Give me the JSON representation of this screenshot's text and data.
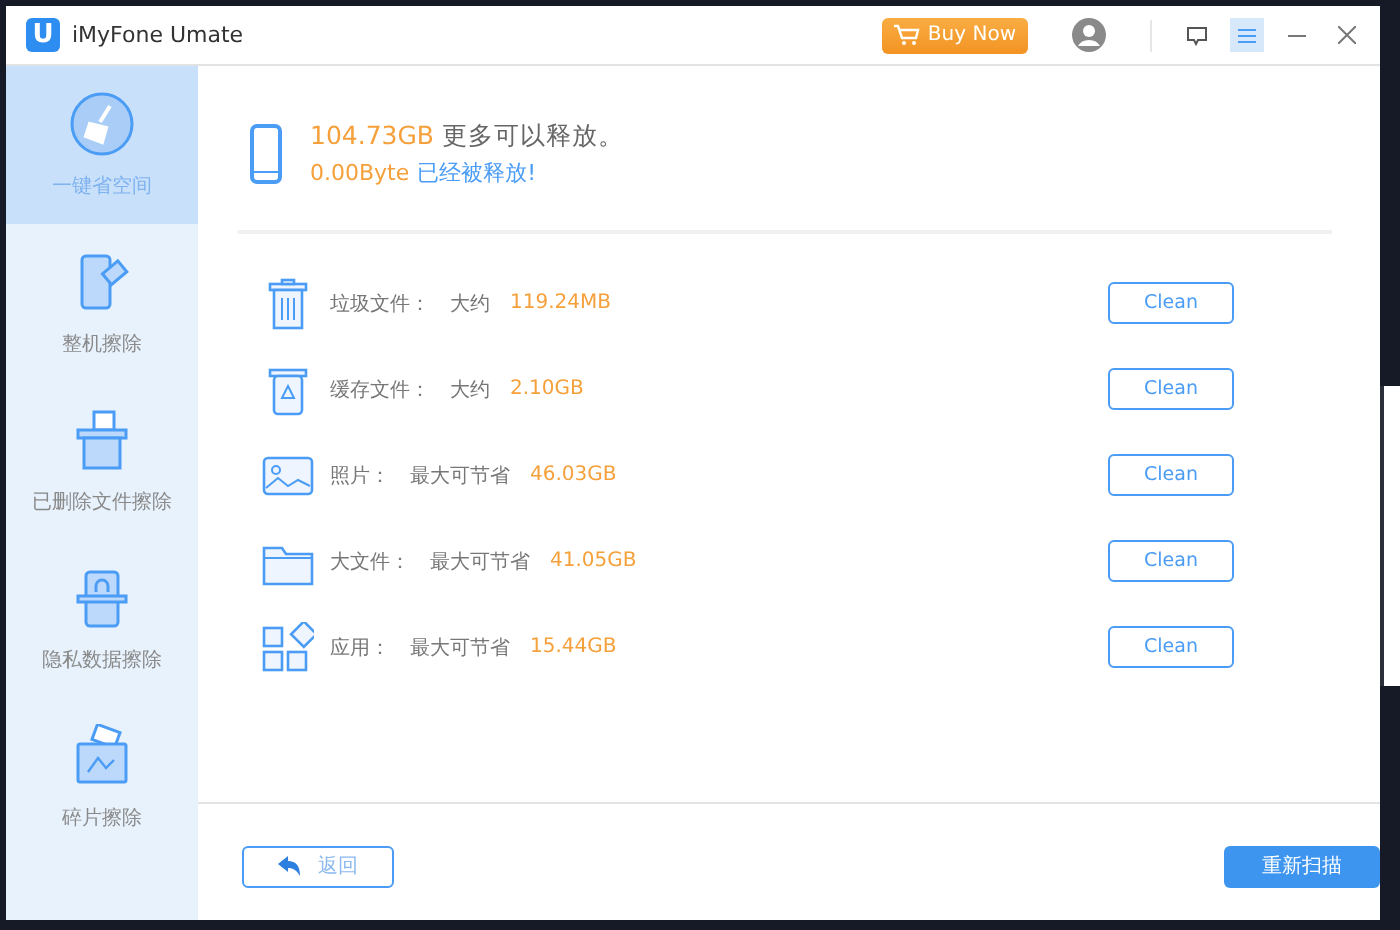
{
  "window": {
    "title": "iMyFone Umate",
    "logo": "U"
  },
  "toolbar": {
    "buy_button": "Buy Now"
  },
  "sidebar": {
    "items": [
      {
        "label": "一键省空间",
        "kind": "broom",
        "selected": true
      },
      {
        "label": "整机擦除",
        "kind": "phone",
        "selected": false
      },
      {
        "label": "已删除文件擦除",
        "kind": "bin",
        "selected": false
      },
      {
        "label": "隐私数据擦除",
        "kind": "lock",
        "selected": false
      },
      {
        "label": "碎片擦除",
        "kind": "folder",
        "selected": false
      }
    ]
  },
  "summary": {
    "amount": "104.73GB",
    "text": "更多可以释放。",
    "freed_amount": "0.00Byte",
    "freed_text": "已经被释放!"
  },
  "rows": [
    {
      "kind": "trash",
      "label": "垃圾文件：",
      "qualifier": "大约",
      "size": "119.24MB",
      "button": "Clean"
    },
    {
      "kind": "cache",
      "label": "缓存文件：",
      "qualifier": "大约",
      "size": "2.10GB",
      "button": "Clean"
    },
    {
      "kind": "photo",
      "label": "照片：",
      "qualifier": "最大可节省",
      "size": "46.03GB",
      "button": "Clean"
    },
    {
      "kind": "folder",
      "label": "大文件：",
      "qualifier": "最大可节省",
      "size": "41.05GB",
      "button": "Clean"
    },
    {
      "kind": "apps",
      "label": "应用：",
      "qualifier": "最大可节省",
      "size": "15.44GB",
      "button": "Clean"
    }
  ],
  "footer": {
    "back_button": "返回",
    "rescan_button": "重新扫描"
  }
}
